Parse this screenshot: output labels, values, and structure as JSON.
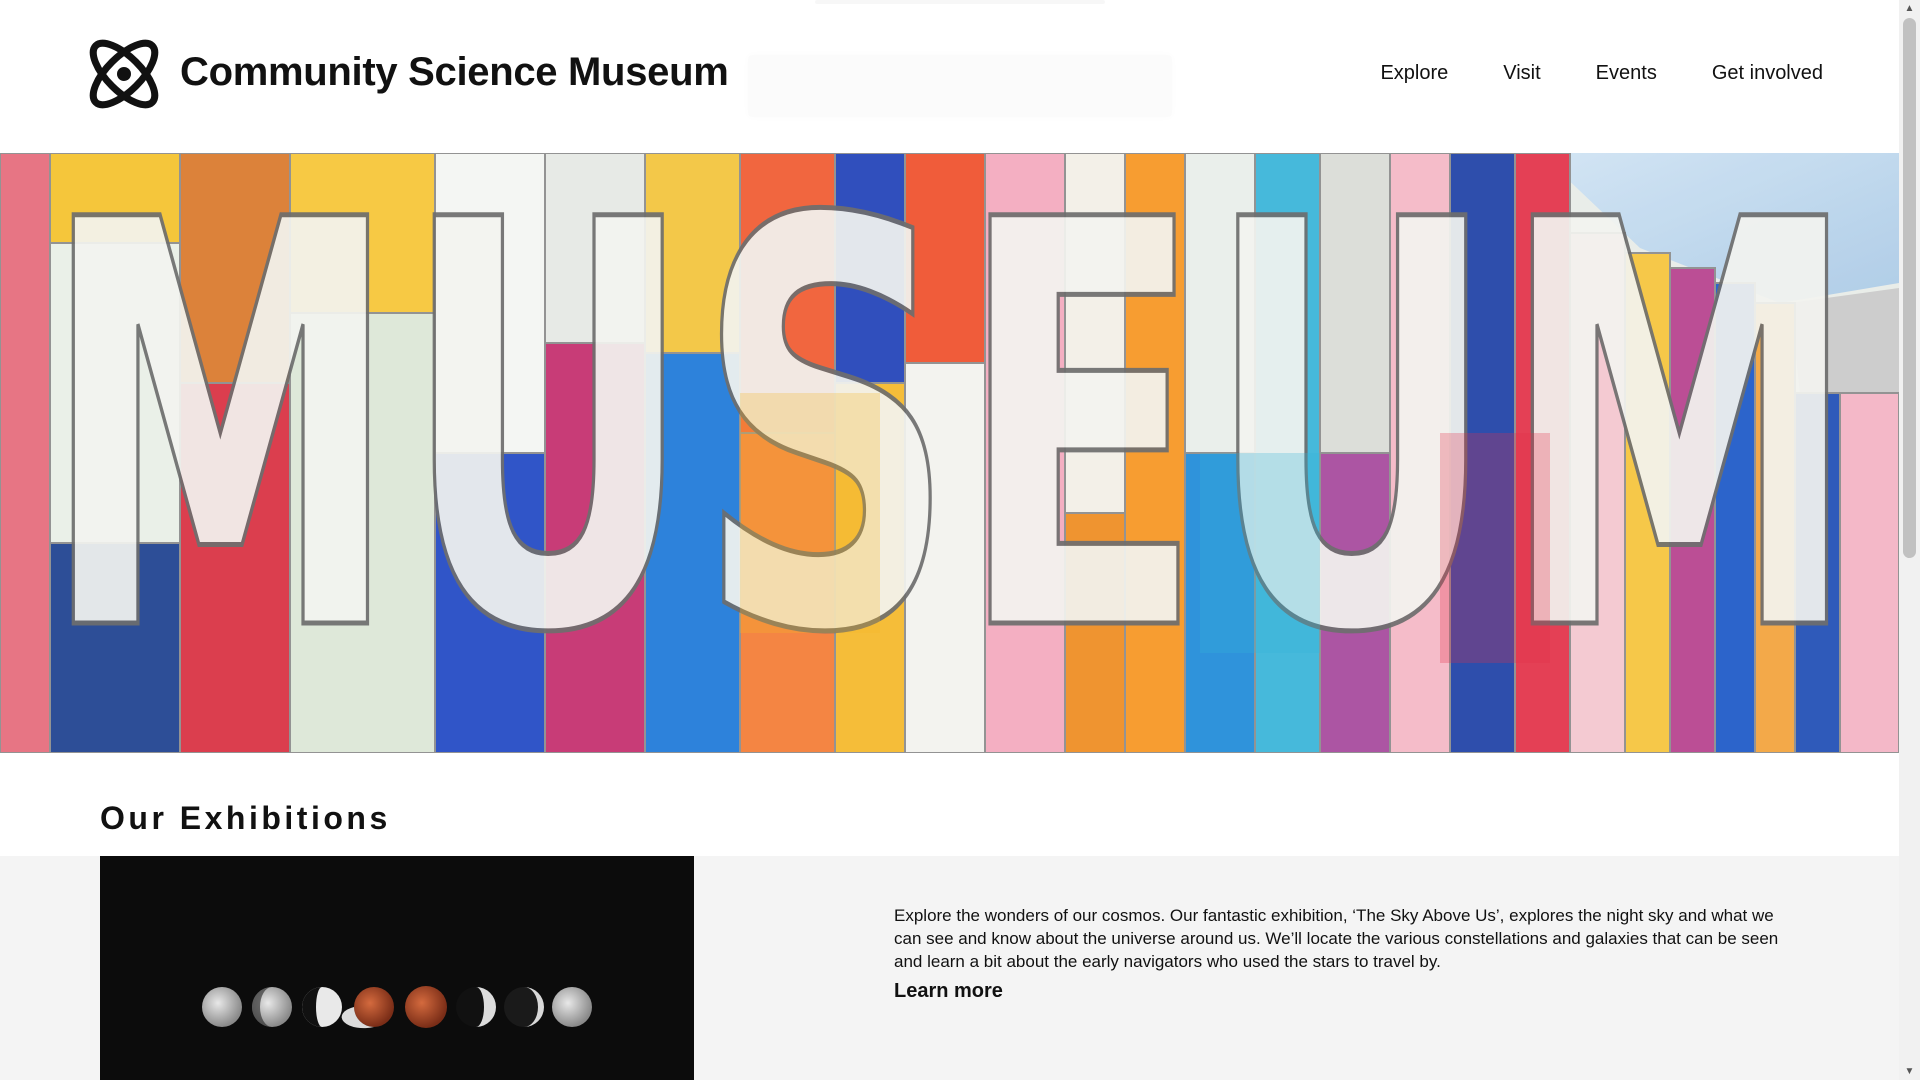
{
  "header": {
    "title": "Community Science Museum",
    "logo_icon": "atom-icon",
    "nav": [
      {
        "label": "Explore"
      },
      {
        "label": "Visit"
      },
      {
        "label": "Events"
      },
      {
        "label": "Get involved"
      }
    ]
  },
  "hero": {
    "image": "colorful-museum-facade-photo",
    "sign_text": "MUSEUM"
  },
  "exhibitions": {
    "heading": "Our Exhibitions",
    "items": [
      {
        "image": "lunar-eclipse-phases-photo",
        "description": "Explore the wonders of our cosmos. Our fantastic exhibition, ‘The Sky Above Us’, explores the night sky and what we can see and know about the universe around us. We’ll locate the various constellations and galaxies that can be seen and learn a bit about the early navigators who used the stars to travel by.",
        "link_label": "Learn more"
      }
    ]
  },
  "colors": {
    "background": "#ffffff",
    "band": "#f4f4f4",
    "text": "#111111",
    "moon_red": "#b5502e"
  }
}
